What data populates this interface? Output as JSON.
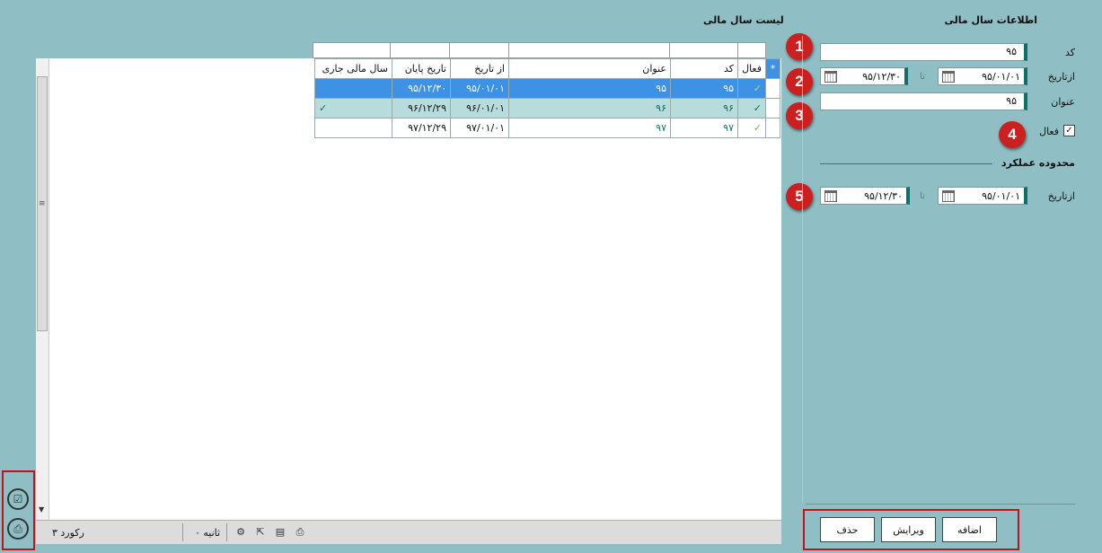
{
  "panel": {
    "title": "اطلاعات سال مالی",
    "code_label": "کد",
    "code_value": "۹۵",
    "from_date_label": "ازتاریخ",
    "from_date_value": "۹۵/۰۱/۰۱",
    "to_label": "تا",
    "to_date_value": "۹۵/۱۲/۳۰",
    "title_label": "عنوان",
    "title_value": "۹۵",
    "active_label": "فعال",
    "active_checked": "✓",
    "scope_title": "محدوده عملکرد",
    "scope_from_label": "ازتاریخ",
    "scope_from_value": "۹۵/۰۱/۰۱",
    "scope_to_label": "تا",
    "scope_to_value": "۹۵/۱۲/۳۰"
  },
  "badges": [
    "1",
    "2",
    "3",
    "4",
    "5"
  ],
  "buttons": {
    "add": "اضافه",
    "edit": "ویرایش",
    "delete": "حذف"
  },
  "list": {
    "title": "لیست سال مالی",
    "star": "*",
    "columns": [
      "فعال",
      "کد",
      "عنوان",
      "از تاریخ",
      "تاریخ پایان",
      "سال مالی جاری"
    ],
    "rows": [
      {
        "active": "✓",
        "code": "۹۵",
        "title": "۹۵",
        "from": "۹۵/۰۱/۰۱",
        "to": "۹۵/۱۲/۳۰",
        "current": ""
      },
      {
        "active": "✓",
        "code": "۹۶",
        "title": "۹۶",
        "from": "۹۶/۰۱/۰۱",
        "to": "۹۶/۱۲/۲۹",
        "current": "✓"
      },
      {
        "active": "✓",
        "code": "۹۷",
        "title": "۹۷",
        "from": "۹۷/۰۱/۰۱",
        "to": "۹۷/۱۲/۲۹",
        "current": ""
      }
    ]
  },
  "status": {
    "records": "۳ رکورد",
    "seconds": "۰ ثانیه"
  },
  "icons": {
    "calendar": "calendar-icon",
    "check": "check-icon",
    "print": "print-icon",
    "settings": "gear-icon",
    "export": "export-icon",
    "preview": "preview-icon",
    "task": "task-icon"
  },
  "colors": {
    "background": "#8fbfc4",
    "selected_row": "#3d92e6",
    "alt_row": "#b8dcdc",
    "badge": "#cc1f1f",
    "frame": "#c0141a"
  }
}
